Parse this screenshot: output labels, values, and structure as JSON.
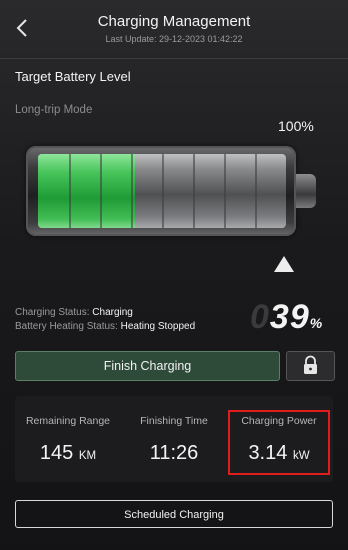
{
  "header": {
    "title": "Charging Management",
    "last_update": "Last Update: 29-12-2023 01:42:22"
  },
  "target": {
    "label": "Target Battery Level",
    "mode": "Long-trip Mode",
    "percent_text": "100%",
    "target_level": 1.0
  },
  "battery": {
    "charge_level": 0.39,
    "segments": 8
  },
  "status": {
    "charging_label": "Charging Status:",
    "charging_value": "Charging",
    "heating_label": "Battery Heating Status:",
    "heating_value": "Heating Stopped",
    "percent_value": "39",
    "percent_unit": "%"
  },
  "actions": {
    "finish_label": "Finish Charging",
    "scheduled_label": "Scheduled Charging"
  },
  "stats": {
    "range_label": "Remaining Range",
    "range_value": "145",
    "range_unit": "KM",
    "finish_label": "Finishing Time",
    "finish_value": "11:26",
    "power_label": "Charging Power",
    "power_value": "3.14",
    "power_unit": "kW"
  },
  "icons": {
    "back": "chevron-left-icon",
    "lock": "lock-icon",
    "slider": "triangle-up-icon"
  },
  "colors": {
    "accent_green": "#2e4a39",
    "highlight_red": "#e01c1c"
  }
}
